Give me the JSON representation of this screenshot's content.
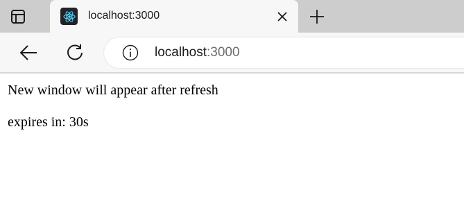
{
  "browser": {
    "tab": {
      "title": "localhost:3000",
      "favicon": "react-icon"
    },
    "address": {
      "host": "localhost",
      "port": ":3000"
    },
    "icons": {
      "tab_actions": "tab-actions-icon",
      "close": "close-icon",
      "new_tab": "plus-icon",
      "back": "back-arrow-icon",
      "reload": "reload-icon",
      "site_info": "info-icon"
    },
    "colors": {
      "tabstrip": "#cdcdcd",
      "active_tab": "#f7f7f7",
      "react_blue": "#61dafb"
    }
  },
  "page": {
    "message": "New window will appear after refresh",
    "expires": "expires in: 30s"
  }
}
